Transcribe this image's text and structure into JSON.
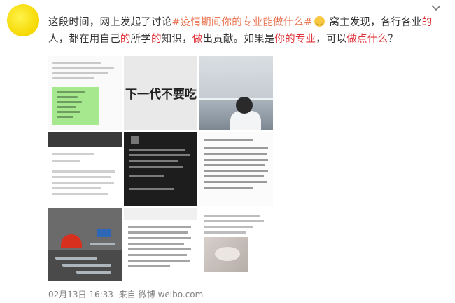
{
  "post": {
    "author_avatar": "avatar-yellow",
    "text_segments": [
      {
        "text": "这段时间，网上发起了讨论",
        "style": "normal"
      },
      {
        "text": "#疫情期间你的专业能做什么#",
        "style": "hashtag"
      },
      {
        "text": " ",
        "style": "normal"
      },
      {
        "text": "窝主发现，各行各业",
        "style": "normal"
      },
      {
        "text": "的",
        "style": "red"
      },
      {
        "text": "人，都在用自己",
        "style": "normal"
      },
      {
        "text": "的",
        "style": "red"
      },
      {
        "text": "所学",
        "style": "normal"
      },
      {
        "text": "的",
        "style": "red"
      },
      {
        "text": "知识，",
        "style": "normal"
      },
      {
        "text": "做",
        "style": "red"
      },
      {
        "text": "出贡献。如果是",
        "style": "normal"
      },
      {
        "text": "你的专业",
        "style": "red"
      },
      {
        "text": "，可以",
        "style": "normal"
      },
      {
        "text": "做点什么",
        "style": "red"
      },
      {
        "text": "？",
        "style": "normal"
      }
    ],
    "emoji_icon": "smile-emoji-icon",
    "images": [
      {
        "kind": "chat-screenshot"
      },
      {
        "kind": "text-image",
        "caption": "下一代不要吃野"
      },
      {
        "kind": "doctor-photo"
      },
      {
        "kind": "list-screenshot"
      },
      {
        "kind": "dark-chat-screenshot"
      },
      {
        "kind": "text-document"
      },
      {
        "kind": "tools-photo"
      },
      {
        "kind": "article-screenshot"
      },
      {
        "kind": "cat-post-screenshot"
      }
    ],
    "footer": {
      "date": "02月13日 16:33",
      "source_prefix": "来自",
      "source": "微博 weibo.com"
    }
  },
  "colors": {
    "hashtag": "#eb7350",
    "red_text": "#e0343a",
    "footer_text": "#808080"
  },
  "icons": {
    "menu": "chevron-down-icon"
  }
}
